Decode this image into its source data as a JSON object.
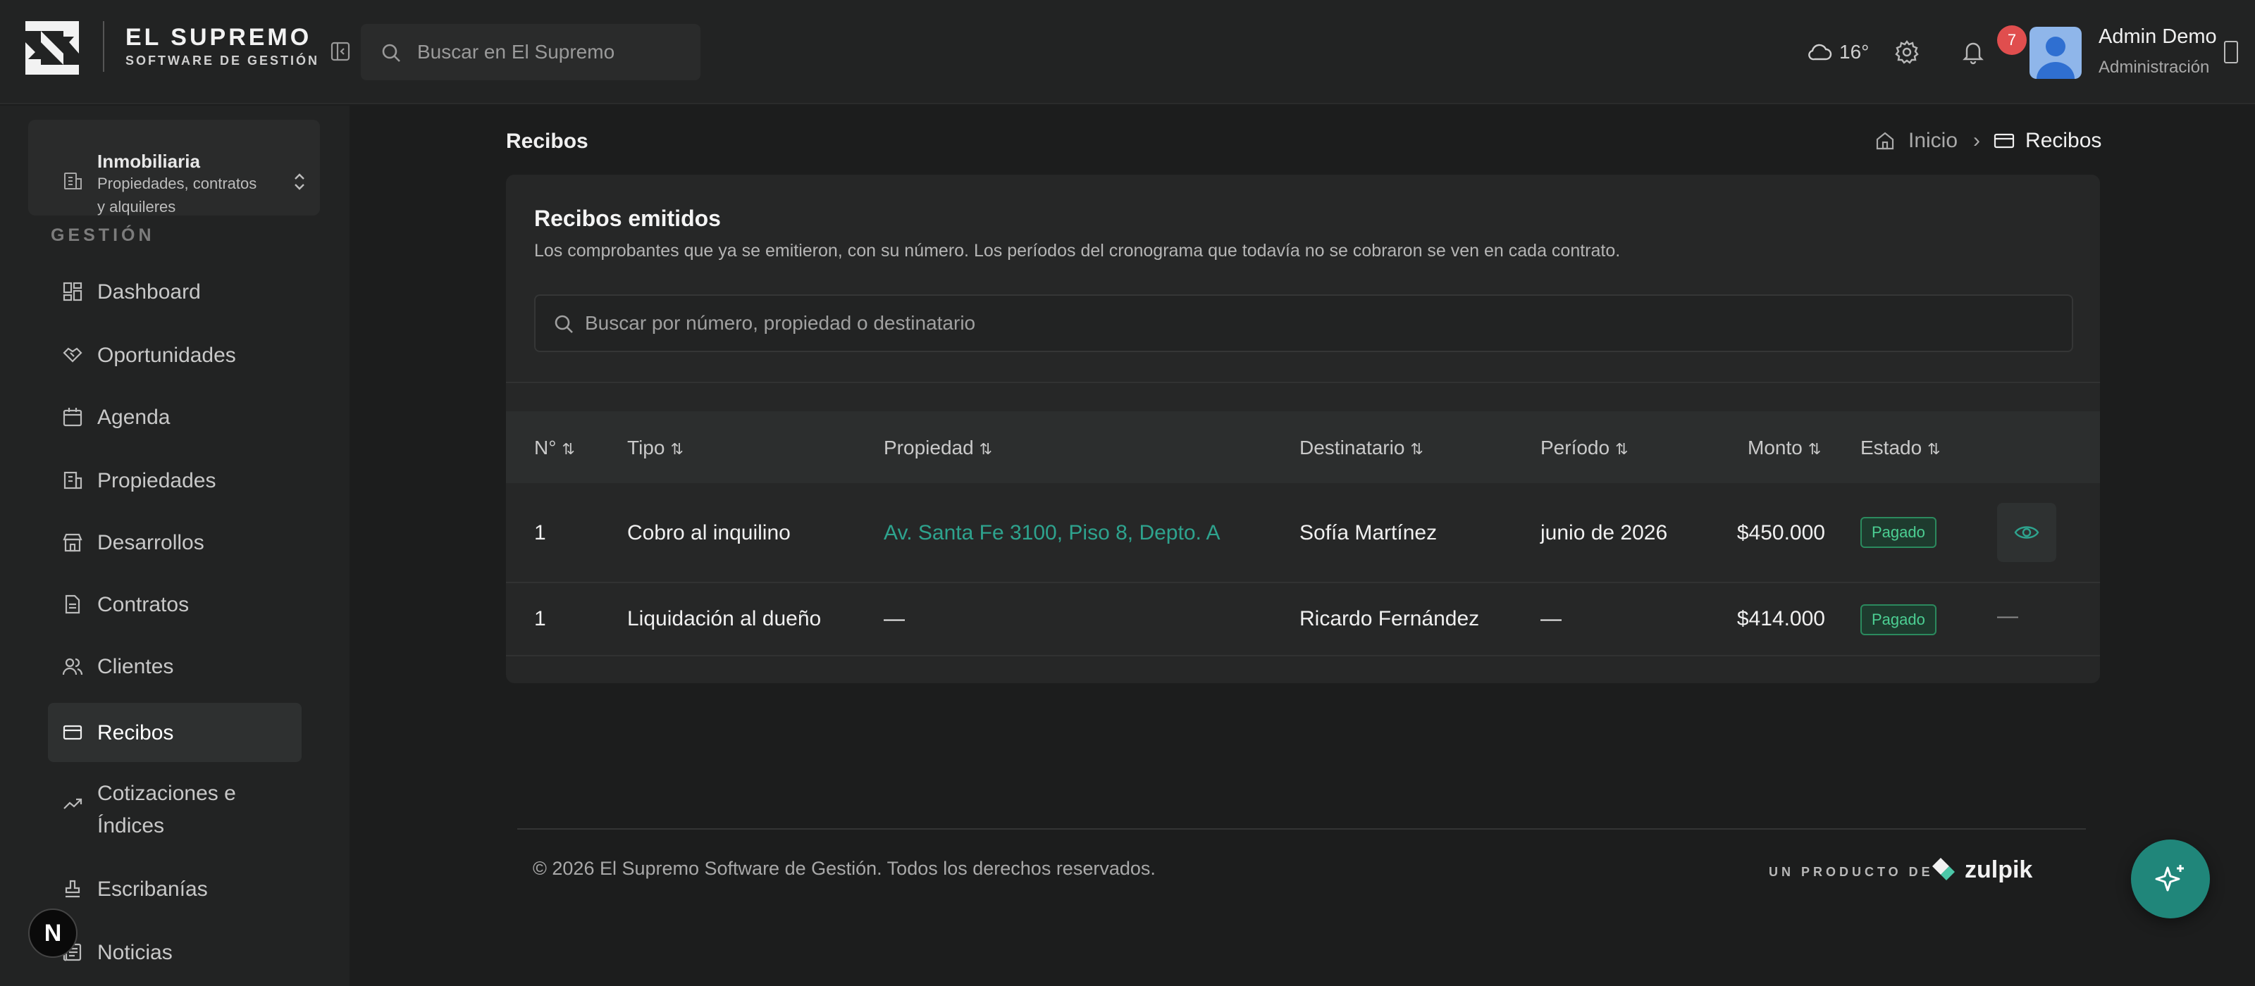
{
  "header": {
    "brand_title": "EL SUPREMO",
    "brand_subtitle": "SOFTWARE DE GESTIÓN",
    "search_placeholder": "Buscar en El Supremo",
    "weather": "16°",
    "notification_count": "7",
    "user_name": "Admin Demo",
    "user_role": "Administración"
  },
  "sidebar": {
    "org_name": "Inmobiliaria",
    "org_desc": "Propiedades, contratos y alquileres",
    "section_label": "GESTIÓN",
    "items": [
      {
        "label": "Dashboard",
        "icon": "dashboard-icon"
      },
      {
        "label": "Oportunidades",
        "icon": "handshake-icon"
      },
      {
        "label": "Agenda",
        "icon": "calendar-icon"
      },
      {
        "label": "Propiedades",
        "icon": "building-icon"
      },
      {
        "label": "Desarrollos",
        "icon": "store-icon"
      },
      {
        "label": "Contratos",
        "icon": "document-icon"
      },
      {
        "label": "Clientes",
        "icon": "users-icon"
      },
      {
        "label": "Recibos",
        "icon": "card-icon",
        "active": true
      },
      {
        "label": "Cotizaciones e Índices",
        "icon": "trend-icon"
      },
      {
        "label": "Escribanías",
        "icon": "stamp-icon"
      },
      {
        "label": "Noticias",
        "icon": "newspaper-icon"
      }
    ]
  },
  "page": {
    "title": "Recibos",
    "breadcrumb_home": "Inicio",
    "breadcrumb_separator": "›",
    "breadcrumb_current": "Recibos"
  },
  "card": {
    "title": "Recibos emitidos",
    "description": "Los comprobantes que ya se emitieron, con su número. Los períodos del cronograma que todavía no se cobraron se ven en cada contrato.",
    "search_placeholder": "Buscar por número, propiedad o destinatario"
  },
  "table": {
    "columns": [
      "N°",
      "Tipo",
      "Propiedad",
      "Destinatario",
      "Período",
      "Monto",
      "Estado"
    ],
    "sort_glyph": "⇅",
    "rows": [
      {
        "numero": "1",
        "tipo": "Cobro al inquilino",
        "propiedad": "Av. Santa Fe 3100, Piso 8, Depto. A",
        "destinatario": "Sofía Martínez",
        "periodo": "junio de 2026",
        "monto": "$450.000",
        "estado": "Pagado",
        "action": ""
      },
      {
        "numero": "1",
        "tipo": "Liquidación al dueño",
        "propiedad": "—",
        "destinatario": "Ricardo Fernández",
        "periodo": "—",
        "monto": "$414.000",
        "estado": "Pagado",
        "action": "—"
      }
    ]
  },
  "footer": {
    "copyright": "© 2026 El Supremo Software de Gestión. Todos los derechos reservados.",
    "producto": "UN PRODUCTO DE",
    "zulpik": "zulpik"
  },
  "next_badge": "N",
  "colors": {
    "accent": "#2ea38e",
    "fab": "#20867a",
    "status_paid": "#4ccf93",
    "badge": "#e04e4e"
  }
}
